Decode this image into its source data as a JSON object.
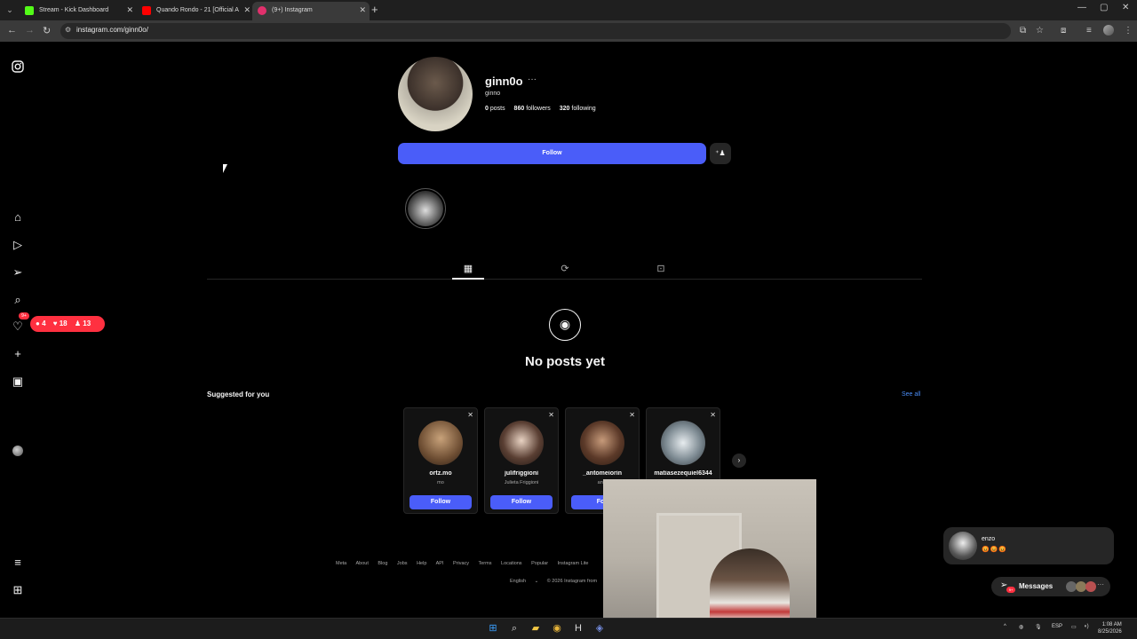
{
  "browser": {
    "tabs": [
      {
        "title": "Stream - Kick Dashboard",
        "favicon_color": "#53fc18"
      },
      {
        "title": "Quando Rondo - 21 [Official A",
        "favicon_color": "#ff0000"
      },
      {
        "title": "(9+) Instagram",
        "favicon_color": "#e1306c"
      }
    ],
    "url": "instagram.com/ginn0o/"
  },
  "sidebar": {
    "messages_badge": "9+",
    "notifications": {
      "comments": "4",
      "likes": "18",
      "follows": "13"
    }
  },
  "profile": {
    "username": "ginn0o",
    "more": "···",
    "full_name": "ginno",
    "posts_count": "0",
    "posts_label": "posts",
    "followers_count": "860",
    "followers_label": "followers",
    "following_count": "320",
    "following_label": "following",
    "follow_button": "Follow"
  },
  "empty_state": {
    "title": "No posts yet"
  },
  "suggestions": {
    "title": "Suggested for you",
    "see_all": "See all",
    "cards": [
      {
        "username": "ortz.mo",
        "subtitle": "mo",
        "button": "Follow"
      },
      {
        "username": "julifriggioni",
        "subtitle": "Julieta Friggioni",
        "button": "Follow"
      },
      {
        "username": "_antomeiorin",
        "subtitle": "anto",
        "button": "Foll"
      },
      {
        "username": "matiasezequiel6344",
        "subtitle": "",
        "button": ""
      }
    ]
  },
  "footer": {
    "links": [
      "Meta",
      "About",
      "Blog",
      "Jobs",
      "Help",
      "API",
      "Privacy",
      "Terms",
      "Locations",
      "Popular",
      "Instagram Lite"
    ],
    "language": "English",
    "copyright": "© 2026 Instagram from"
  },
  "chat": {
    "recent_name": "enzo",
    "recent_reactions": "😡😡😡",
    "messages_label": "Messages",
    "messages_badge": "9+",
    "more": "···"
  },
  "taskbar": {
    "lang": "ESP",
    "time": "1:08 AM",
    "date": "8/25/2026"
  },
  "colors": {
    "follow_blue": "#4a5df9",
    "badge_red": "#ff3040",
    "link_blue": "#4a8cf5"
  }
}
